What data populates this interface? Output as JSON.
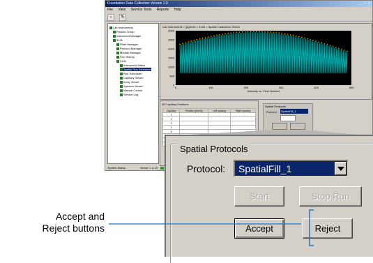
{
  "background_window": {
    "title": "Foundation Data Collection Version 1.0",
    "window_controls": "_ □ ×",
    "menu": [
      "File",
      "View",
      "Service Tools",
      "Reports",
      "Help"
    ],
    "tree": {
      "items": [
        {
          "label": "Lab Instruments",
          "depth": 0
        },
        {
          "label": "Results Group",
          "depth": 1
        },
        {
          "label": "Instrument Manager",
          "depth": 1
        },
        {
          "label": "3130",
          "depth": 1
        },
        {
          "label": "Plate Manager",
          "depth": 2
        },
        {
          "label": "Protocol Manager",
          "depth": 2
        },
        {
          "label": "Module Manager",
          "depth": 2
        },
        {
          "label": "Run History",
          "depth": 2
        },
        {
          "label": "3130",
          "depth": 2
        },
        {
          "label": "Instrument Status",
          "depth": 3
        },
        {
          "label": "Spatial Run Scheduler",
          "depth": 3,
          "selected": true
        },
        {
          "label": "Run Scheduler",
          "depth": 3
        },
        {
          "label": "Capillary Viewer",
          "depth": 3
        },
        {
          "label": "Array Viewer",
          "depth": 3
        },
        {
          "label": "Spectral Viewer",
          "depth": 3
        },
        {
          "label": "Manual Control",
          "depth": 3
        },
        {
          "label": "Service Log",
          "depth": 3
        }
      ]
    },
    "plot_title": "Lab Instruments > gig3130 > 3130 > Spatial Calibration Viewer",
    "plot_x_label": "Intensity vs. Pixel Number",
    "y_ticks": [
      "3000",
      "2500",
      "2000",
      "1500",
      "1000",
      "500",
      "0"
    ],
    "x_ticks": [
      "0",
      "100",
      "200",
      "300",
      "400",
      "500"
    ],
    "capillary_panel_title": "All Capillary Positions",
    "capillary_columns": [
      "Capillary",
      "Position (pixels)",
      "Left spacing",
      "Right spacing"
    ],
    "capillary_rows": [
      [
        "1",
        "",
        "",
        ""
      ],
      [
        "2",
        "",
        "",
        ""
      ],
      [
        "3",
        "",
        "",
        ""
      ],
      [
        "4",
        "",
        "",
        ""
      ],
      [
        "5",
        "",
        "",
        ""
      ],
      [
        "6",
        "",
        "",
        ""
      ],
      [
        "7",
        "",
        "",
        ""
      ],
      [
        "8",
        "",
        "",
        ""
      ]
    ],
    "small_spatial_title": "Spatial Protocols",
    "small_protocol_label": "Protocol",
    "small_protocol_value": "SpatialFill_1",
    "status_text": "System Status",
    "status_right": "Server: 1.0.10"
  },
  "spatial_protocols": {
    "group_title": "Spatial Protocols",
    "protocol_label": "Protocol:",
    "protocol_value": "SpatialFill_1",
    "start_label": "Start",
    "stop_label": "Stop Run",
    "accept_label": "Accept",
    "reject_label": "Reject"
  },
  "callout": {
    "line1": "Accept and",
    "line2": "Reject buttons"
  },
  "colors": {
    "highlight": "#0a246a",
    "callout_line": "#1f77c4",
    "panel": "#d4d0c8",
    "plot_trace": "#00b3b3",
    "plot_marker": "#f0a000"
  }
}
